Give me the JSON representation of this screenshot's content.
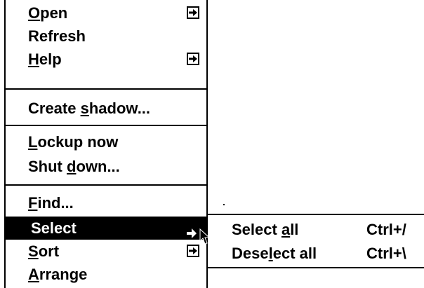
{
  "menu": {
    "items": [
      {
        "text": "Open",
        "underline_index": 0,
        "has_submenu": true
      },
      {
        "text": "Refresh",
        "underline_index": -1,
        "has_submenu": false
      },
      {
        "text": "Help",
        "underline_index": 0,
        "has_submenu": true
      },
      {
        "text": "Create shadow...",
        "underline_index": 7,
        "has_submenu": false
      },
      {
        "text": "Lockup now",
        "underline_index": 0,
        "has_submenu": false
      },
      {
        "text": "Shut down...",
        "underline_index": 5,
        "has_submenu": false
      },
      {
        "text": "Find...",
        "underline_index": 0,
        "has_submenu": false
      },
      {
        "text": "Select",
        "underline_index": -1,
        "has_submenu": true,
        "highlighted": true
      },
      {
        "text": "Sort",
        "underline_index": 0,
        "has_submenu": true
      },
      {
        "text": "Arrange",
        "underline_index": 0,
        "has_submenu": false
      }
    ]
  },
  "submenu": {
    "items": [
      {
        "text": "Select all",
        "underline_index": 7,
        "accelerator": "Ctrl+/"
      },
      {
        "text": "Deselect all",
        "underline_index": 4,
        "accelerator": "Ctrl+\\"
      }
    ]
  },
  "colors": {
    "background": "#ffffff",
    "foreground": "#000000",
    "highlight_bg": "#000000",
    "highlight_fg": "#ffffff"
  },
  "icons": {
    "submenu_arrow": "right-arrow-box-icon",
    "highlighted_arrow": "right-arrow-icon",
    "cursor": "mouse-pointer-icon"
  }
}
